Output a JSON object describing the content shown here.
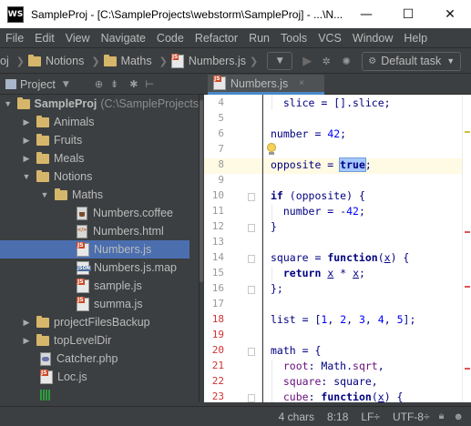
{
  "window": {
    "app_icon_label": "WS",
    "title": "SampleProj - [C:\\SampleProjects\\webstorm\\SampleProj] - ...\\N...",
    "minimize": "—",
    "maximize": "☐",
    "close": "✕"
  },
  "menu": [
    "File",
    "Edit",
    "View",
    "Navigate",
    "Code",
    "Refactor",
    "Run",
    "Tools",
    "VCS",
    "Window",
    "Help"
  ],
  "navbar": {
    "crumbs": [
      "oj",
      "Notions",
      "Maths",
      "Numbers.js"
    ],
    "run_config": "Default task"
  },
  "project_panel": {
    "label": "Project",
    "items": [
      {
        "label": "SampleProj",
        "path": "(C:\\SampleProjects",
        "arrow": "▼",
        "icon": "folder-icon"
      },
      {
        "label": "Animals",
        "arrow": "▶",
        "icon": "folder-icon"
      },
      {
        "label": "Fruits",
        "arrow": "▶",
        "icon": "folder-icon"
      },
      {
        "label": "Meals",
        "arrow": "▶",
        "icon": "folder-icon"
      },
      {
        "label": "Notions",
        "arrow": "▼",
        "icon": "folder-icon"
      },
      {
        "label": "Maths",
        "arrow": "▼",
        "icon": "folder-icon"
      },
      {
        "label": "Numbers.coffee",
        "icon": "coffee-file-icon"
      },
      {
        "label": "Numbers.html",
        "icon": "html-file-icon"
      },
      {
        "label": "Numbers.js",
        "icon": "js-file-icon",
        "selected": true
      },
      {
        "label": "Numbers.js.map",
        "icon": "json-file-icon"
      },
      {
        "label": "sample.js",
        "icon": "js-file-icon"
      },
      {
        "label": "summa.js",
        "icon": "js-file-icon"
      },
      {
        "label": "projectFilesBackup",
        "arrow": "▶",
        "icon": "folder-icon"
      },
      {
        "label": "topLevelDir",
        "arrow": "▶",
        "icon": "folder-icon"
      },
      {
        "label": "Catcher.php",
        "icon": "php-file-icon"
      },
      {
        "label": "Loc.js",
        "icon": "js-file-icon"
      },
      {
        "label": "",
        "icon": "library-icon"
      }
    ]
  },
  "editor": {
    "tab_label": "Numbers.js",
    "tab_close": "×",
    "line_numbers": [
      "4",
      "5",
      "6",
      "7",
      "8",
      "9",
      "10",
      "11",
      "12",
      "13",
      "14",
      "15",
      "16",
      "17",
      "18",
      "19",
      "20",
      "21",
      "22",
      "23"
    ],
    "red_lines": [
      "18",
      "19",
      "20",
      "21",
      "22",
      "23"
    ]
  },
  "status": {
    "chars": "4 chars",
    "position": "8:18",
    "line_sep": "LF÷",
    "encoding": "UTF-8÷"
  },
  "colors": {
    "accent": "#4a88c7",
    "selection": "#4b6eaf",
    "current_line": "#fffae3"
  }
}
